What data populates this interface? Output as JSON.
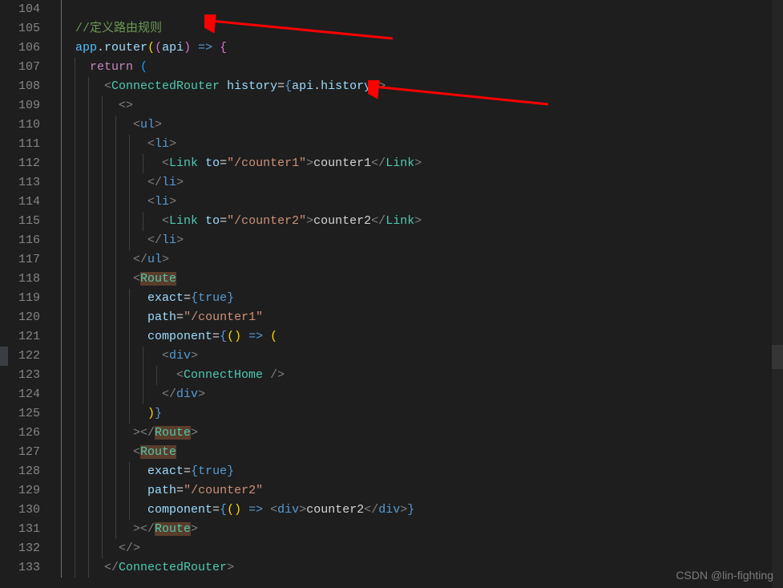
{
  "editor": {
    "startLine": 104,
    "lines": [
      "104",
      "105",
      "106",
      "107",
      "108",
      "109",
      "110",
      "111",
      "112",
      "113",
      "114",
      "115",
      "116",
      "117",
      "118",
      "119",
      "120",
      "121",
      "122",
      "123",
      "124",
      "125",
      "126",
      "127",
      "128",
      "129",
      "130",
      "131",
      "132",
      "133"
    ]
  },
  "code": {
    "l105": "//定义路由规则",
    "l106_obj": "app",
    "l106_method": "router",
    "l106_param": "api",
    "l107_return": "return",
    "l108_tag": "ConnectedRouter",
    "l108_attr": "history",
    "l108_expr1": "api",
    "l108_expr2": "history",
    "l110_ul": "ul",
    "l111_li": "li",
    "l112_link": "Link",
    "l112_to": "to",
    "l112_path": "\"/counter1\"",
    "l112_txt": "counter1",
    "l113_li": "li",
    "l114_li": "li",
    "l115_link": "Link",
    "l115_to": "to",
    "l115_path": "\"/counter2\"",
    "l115_txt": "counter2",
    "l116_li": "li",
    "l117_ul": "ul",
    "l118_route": "Route",
    "l119_exact": "exact",
    "l119_true": "true",
    "l120_path": "path",
    "l120_val": "\"/counter1\"",
    "l121_comp": "component",
    "l122_div": "div",
    "l123_ch": "ConnectHome",
    "l124_div": "div",
    "l126_route": "Route",
    "l127_route": "Route",
    "l128_exact": "exact",
    "l128_true": "true",
    "l129_path": "path",
    "l129_val": "\"/counter2\"",
    "l130_comp": "component",
    "l130_div": "div",
    "l130_txt": "counter2",
    "l131_route": "Route",
    "l133_cr": "ConnectedRouter"
  },
  "watermark": "CSDN @lin-fighting"
}
